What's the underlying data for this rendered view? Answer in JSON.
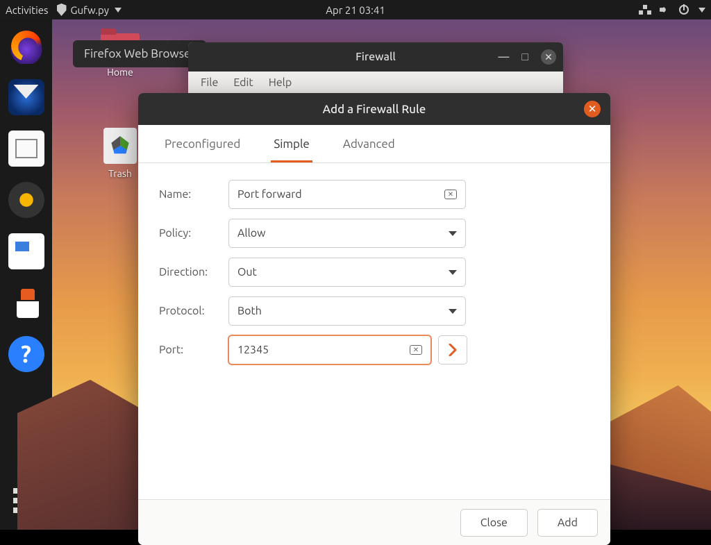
{
  "topbar": {
    "activities": "Activities",
    "app_name": "Gufw.py",
    "clock": "Apr 21  03:41"
  },
  "tooltip": "Firefox Web Browser",
  "desktop_icons": {
    "home": "Home",
    "trash": "Trash"
  },
  "firewall_window": {
    "title": "Firewall",
    "menu": {
      "file": "File",
      "edit": "Edit",
      "help": "Help"
    }
  },
  "modal": {
    "title": "Add a Firewall Rule",
    "tabs": {
      "preconfigured": "Preconfigured",
      "simple": "Simple",
      "advanced": "Advanced"
    },
    "labels": {
      "name": "Name:",
      "policy": "Policy:",
      "direction": "Direction:",
      "protocol": "Protocol:",
      "port": "Port:"
    },
    "values": {
      "name": "Port forward",
      "policy": "Allow",
      "direction": "Out",
      "protocol": "Both",
      "port": "12345"
    },
    "buttons": {
      "close": "Close",
      "add": "Add"
    }
  }
}
